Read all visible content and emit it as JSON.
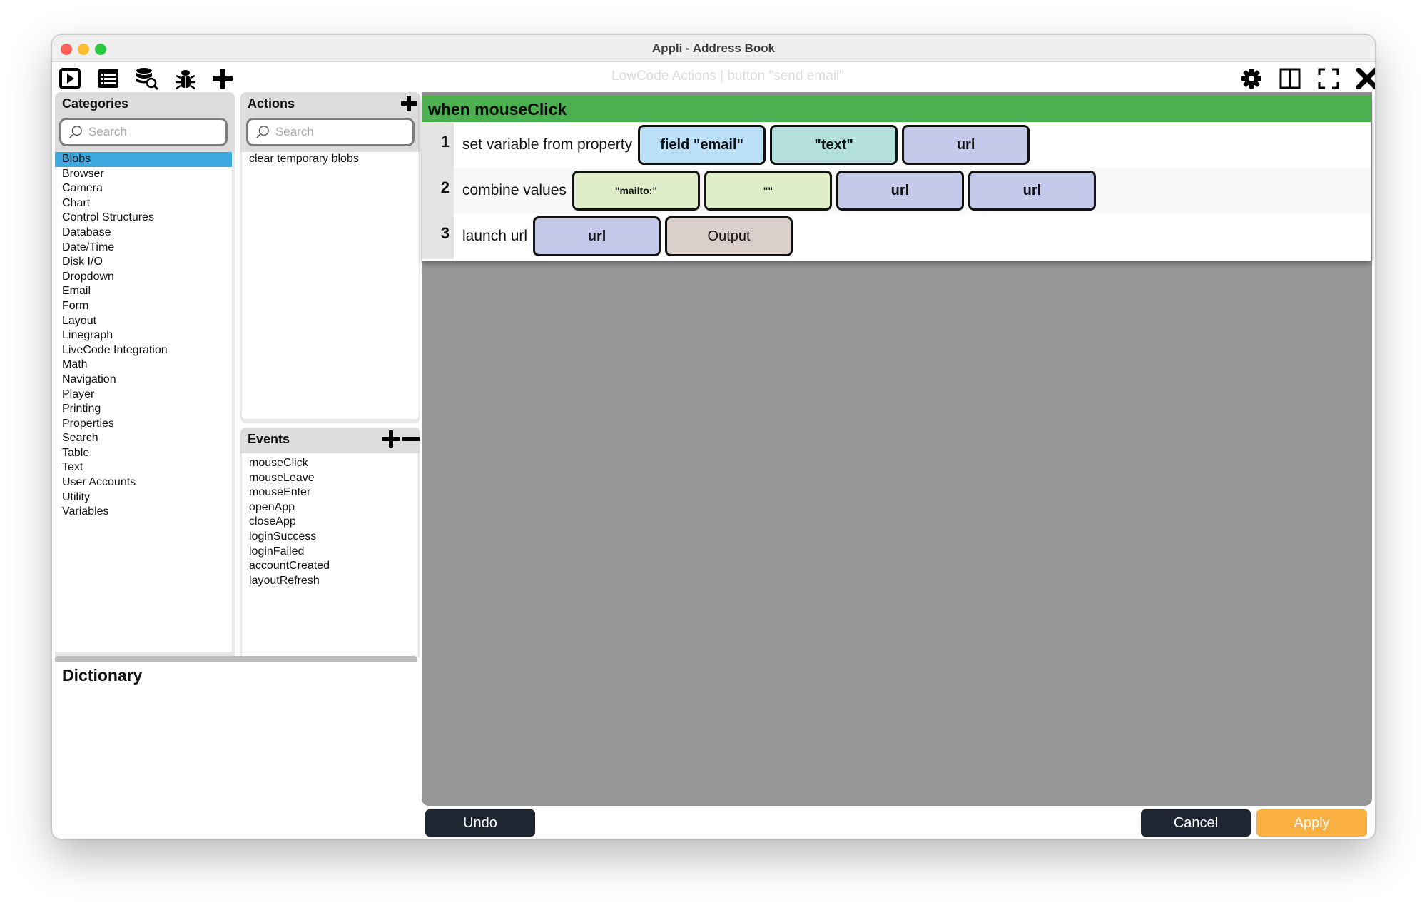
{
  "window": {
    "title": "Appli - Address Book"
  },
  "toolbar": {
    "caption": "LowCode Actions | button \"send email\"",
    "left_icons": [
      "play-icon",
      "list-icon",
      "database-search-icon",
      "bug-icon",
      "plus-icon"
    ],
    "right_icons": [
      "gear-icon",
      "columns-icon",
      "fullscreen-icon",
      "close-icon"
    ]
  },
  "categories": {
    "title": "Categories",
    "search_placeholder": "Search",
    "selected": "Blobs",
    "items": [
      "Blobs",
      "Browser",
      "Camera",
      "Chart",
      "Control Structures",
      "Database",
      "Date/Time",
      "Disk I/O",
      "Dropdown",
      "Email",
      "Form",
      "Layout",
      "Linegraph",
      "LiveCode Integration",
      "Math",
      "Navigation",
      "Player",
      "Printing",
      "Properties",
      "Search",
      "Table",
      "Text",
      "User Accounts",
      "Utility",
      "Variables"
    ]
  },
  "actions": {
    "title": "Actions",
    "search_placeholder": "Search",
    "items": [
      "clear temporary blobs"
    ]
  },
  "events": {
    "title": "Events",
    "items": [
      "mouseClick",
      "mouseLeave",
      "mouseEnter",
      "openApp",
      "closeApp",
      "loginSuccess",
      "loginFailed",
      "accountCreated",
      "layoutRefresh"
    ]
  },
  "dictionary": {
    "title": "Dictionary"
  },
  "script": {
    "event_header": "when mouseClick",
    "lines": [
      {
        "number": "1",
        "label": "set variable from property",
        "params": [
          {
            "text": "field \"email\"",
            "color": "#bcdff8"
          },
          {
            "text": "\"text\"",
            "color": "#b3e0dc"
          },
          {
            "text": "url",
            "color": "#c5c9ea"
          }
        ]
      },
      {
        "number": "2",
        "label": "combine values",
        "params": [
          {
            "text": "\"mailto:\"",
            "color": "#dfedc8"
          },
          {
            "text": "\"\"",
            "color": "#dfedc8"
          },
          {
            "text": "url",
            "color": "#c5c9ea"
          },
          {
            "text": "url",
            "color": "#c5c9ea"
          }
        ]
      },
      {
        "number": "3",
        "label": "launch url",
        "params": [
          {
            "text": "url",
            "color": "#c5c9ea"
          },
          {
            "text": "Output",
            "color": "#dacfcb"
          }
        ]
      }
    ]
  },
  "buttons": {
    "undo": "Undo",
    "cancel": "Cancel",
    "apply": "Apply"
  },
  "colors": {
    "event_header": "#4caf50",
    "selection": "#3ea8e0",
    "apply": "#f9b040",
    "dark_button": "#1f2633",
    "canvas": "#969696"
  }
}
